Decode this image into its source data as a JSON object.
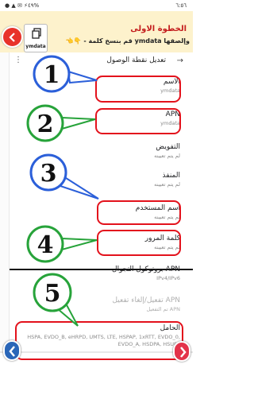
{
  "status_bar": {
    "time": "٦:٥٦",
    "system": "● ▲ ✉ ⚡٤٩%"
  },
  "header": {
    "copy_button_label": "ymdata",
    "step_title": "الخطوة الاولى",
    "step_text": "- قم بنسخ كلمة ymdata وإلصقها",
    "step_emoji": "👈👇"
  },
  "toolbar": {
    "title": "تعديل نقطة الوصول",
    "back_arrow": "→",
    "more": "⋮"
  },
  "items": [
    {
      "title": "الاسم",
      "summary": "ymdata"
    },
    {
      "title": "APN",
      "summary": "ymdata"
    },
    {
      "title": "التفويض",
      "summary": "لم يتم تعيينه"
    },
    {
      "title": "المنفذ",
      "summary": "لم يتم تعيينه"
    },
    {
      "title": "اسم المستخدم",
      "summary": "لم يتم تعيينه"
    },
    {
      "title": "كلمة المرور",
      "summary": "لم يتم تعيينه"
    },
    {
      "title": "بروتوكول التجوال APN",
      "summary": "IPv4/IPv6"
    },
    {
      "title": "تفعيل/إلغاء تفعيل APN",
      "summary": "تم التفعيل APN"
    },
    {
      "title": "الحامل",
      "summary": "HSPA, EVDO_B, eHRPD, UMTS, LTE, HSPAP, 1xRTT, EVDO_0, EVDO_A, HSDPA, HSUPA"
    }
  ],
  "callouts": [
    "1",
    "2",
    "3",
    "4",
    "5"
  ],
  "colors": {
    "highlight": "#e3121c",
    "blue_callout": "#2b5fd9",
    "green_callout": "#27a33a",
    "header_bg": "#fdf2cc",
    "title_red": "#c41e1e"
  }
}
